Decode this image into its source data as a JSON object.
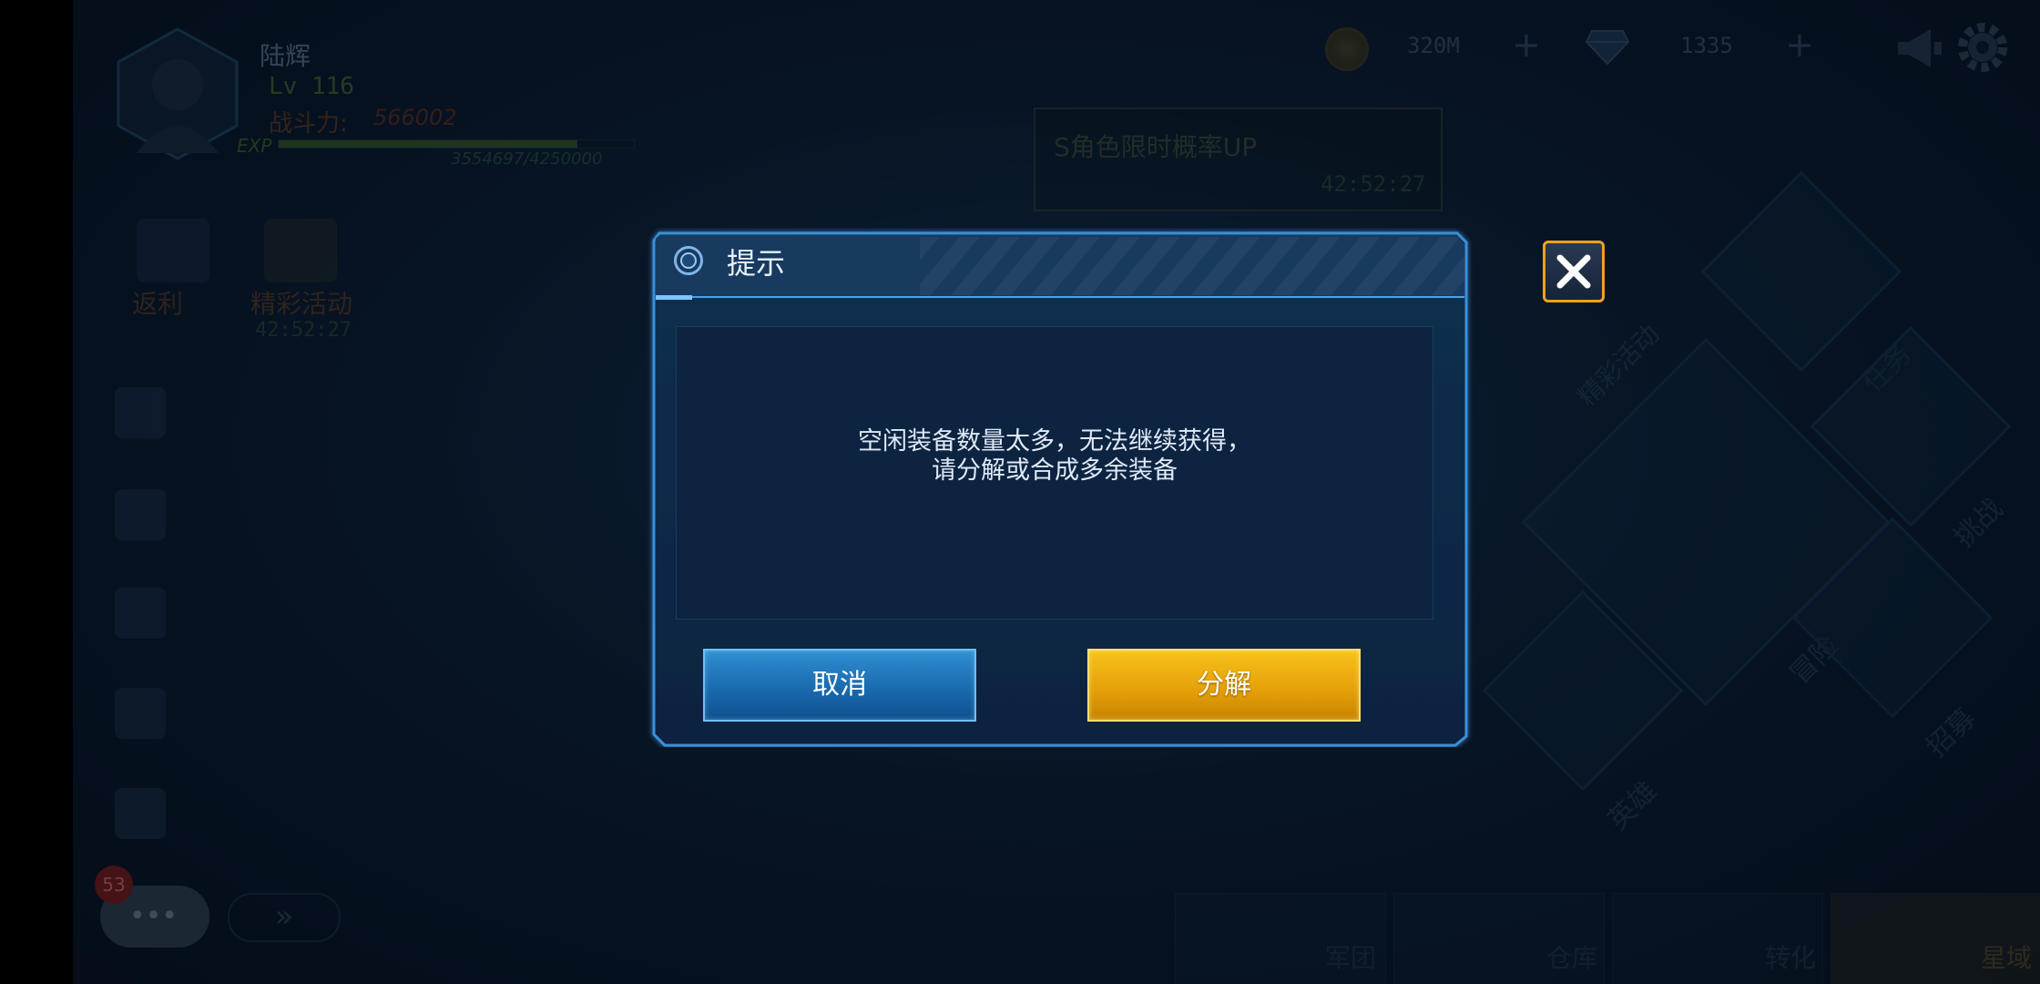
{
  "player": {
    "name": "陆辉",
    "level": "Lv 116",
    "power_label": "战斗力:",
    "power_value": "566002",
    "exp_label": "EXP",
    "exp_value": "3554697/4250000",
    "exp_fraction": 0.84
  },
  "currency": {
    "coins": "320M",
    "gems": "1335",
    "plus": "+"
  },
  "banner": {
    "title": "S角色限时概率UP",
    "timer": "42:52:27"
  },
  "left_menu": {
    "rebate": "返利",
    "events": "精彩活动",
    "events_timer": "42:52:27"
  },
  "chat": {
    "badge_count": "53",
    "dots": "•••",
    "arrow": "»"
  },
  "right_menu": {
    "events": "精彩活动",
    "tasks": "任务",
    "challenge": "挑战",
    "adventure": "冒险",
    "heroes": "英雄",
    "recruit": "招募"
  },
  "bottom_nav": {
    "legion": "军团",
    "warehouse": "仓库",
    "convert": "转化",
    "starport": "星域"
  },
  "dialog": {
    "title": "提示",
    "message_line1": "空闲装备数量太多，无法继续获得，",
    "message_line2": "请分解或合成多余装备",
    "cancel_label": "取消",
    "confirm_label": "分解"
  },
  "colors": {
    "accent_blue": "#2f8fd0",
    "accent_gold": "#f0b014",
    "close_border": "#f0a020"
  }
}
